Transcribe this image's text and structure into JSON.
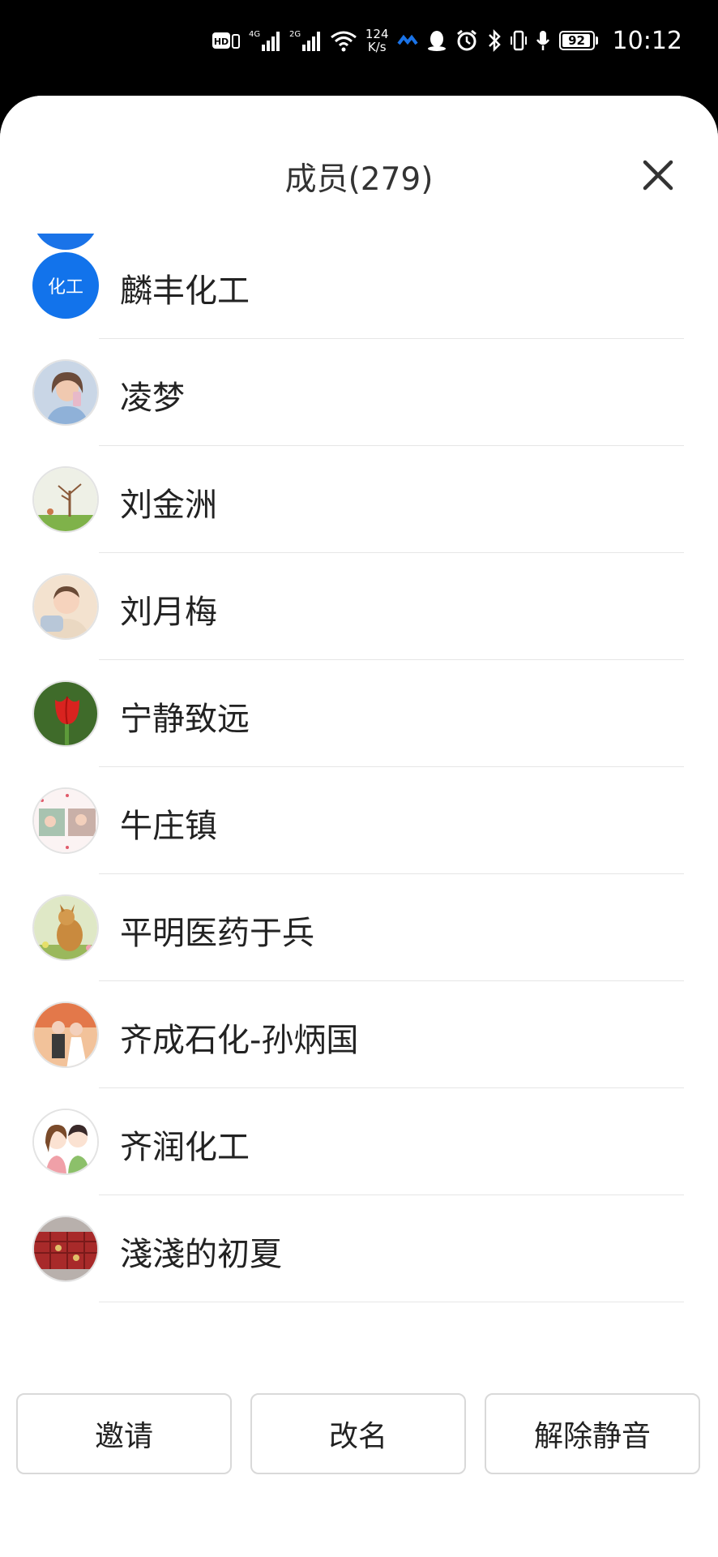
{
  "status_bar": {
    "network_speed_value": "124",
    "network_speed_unit": "K/s",
    "signal_1": "4G",
    "signal_2": "2G",
    "hd": "HD",
    "battery": "92",
    "time": "10:12"
  },
  "header": {
    "title": "成员(279)"
  },
  "members": [
    {
      "name": "麟丰化工",
      "avatar_text": "化工",
      "avatar_color": "#1273eb"
    },
    {
      "name": "凌梦"
    },
    {
      "name": "刘金洲"
    },
    {
      "name": "刘月梅"
    },
    {
      "name": "宁静致远"
    },
    {
      "name": "牛庄镇"
    },
    {
      "name": "平明医药于兵"
    },
    {
      "name": "齐成石化-孙炳国"
    },
    {
      "name": "齐润化工"
    },
    {
      "name": "淺淺的初夏"
    }
  ],
  "actions": {
    "invite": "邀请",
    "rename": "改名",
    "unmute": "解除静音"
  },
  "colors": {
    "accent_blue": "#1273eb",
    "status_bar_bg": "#000000",
    "sheet_bg": "#ffffff"
  }
}
